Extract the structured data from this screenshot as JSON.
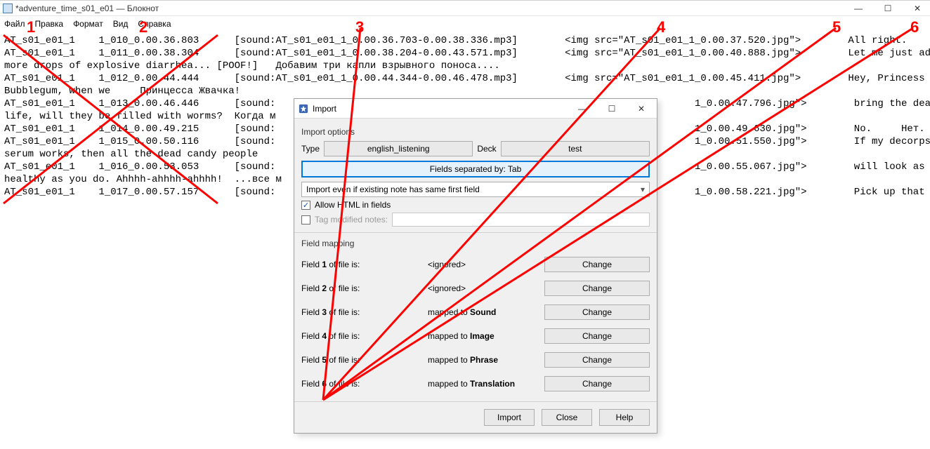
{
  "notepad": {
    "title": "*adventure_time_s01_e01 — Блокнот",
    "menu": [
      "Файл",
      "Правка",
      "Формат",
      "Вид",
      "Справка"
    ],
    "content": "AT_s01_e01_1    1_010_0.00.36.803      [sound:AT_s01_e01_1_0.00.36.703-0.00.38.336.mp3]        <img src=\"AT_s01_e01_1_0.00.37.520.jpg\">        All right.      Итак!\nAT_s01_e01_1    1_011_0.00.38.304      [sound:AT_s01_e01_1_0.00.38.204-0.00.43.571.mp3]        <img src=\"AT_s01_e01_1_0.00.40.888.jpg\">        Let me just add three\nmore drops of explosive diarrhea... [POOF!]   Добавим три капли взрывного поноса....\nAT_s01_e01_1    1_012_0.00.44.444      [sound:AT_s01_e01_1_0.00.44.344-0.00.46.478.mp3]        <img src=\"AT_s01_e01_1_0.00.45.411.jpg\">        Hey, Princess\nBubblegum, when we     Принцесса Жвачка!\nAT_s01_e01_1    1_013_0.00.46.446      [sound:                                                                       1_0.00.47.796.jpg\">        bring the dead back t\nlife, will they be filled with worms?  Когда м\nAT_s01_e01_1    1_014_0.00.49.215      [sound:                                                                       1_0.00.49.630.jpg\">        No.     Нет.\nAT_s01_e01_1    1_015_0.00.50.116      [sound:                                                                       1_0.00.51.550.jpg\">        If my decorpsinator\nserum works, then all the dead candy people\nAT_s01_e01_1    1_016_0.00.53.053      [sound:                                                                       1_0.00.55.067.jpg\">        will look as young an\nhealthy as you do. Ahhhh-ahhhh-ahhhh!  ...все м\nAT_s01_e01_1    1_017_0.00.57.157      [sound:                                                                       1_0.00.58.221.jpg\">        Pick up that platter."
  },
  "dialog": {
    "title": "Import",
    "section_options": "Import options",
    "type_label": "Type",
    "type_value": "english_listening",
    "deck_label": "Deck",
    "deck_value": "test",
    "fields_sep_btn": "Fields separated by: Tab",
    "import_mode": "Import even if existing note has same first field",
    "allow_html": "Allow HTML in fields",
    "tag_modified": "Tag modified notes:",
    "section_fieldmap": "Field mapping",
    "fields": [
      {
        "idx": "1",
        "label_pre": "Field ",
        "label_post": " of file is:",
        "value": "<ignored>",
        "value_b": "",
        "btn": "Change"
      },
      {
        "idx": "2",
        "label_pre": "Field ",
        "label_post": " of file is:",
        "value": "<ignored>",
        "value_b": "",
        "btn": "Change"
      },
      {
        "idx": "3",
        "label_pre": "Field ",
        "label_post": " of file is:",
        "value": "mapped to ",
        "value_b": "Sound",
        "btn": "Change"
      },
      {
        "idx": "4",
        "label_pre": "Field ",
        "label_post": " of file is:",
        "value": "mapped to ",
        "value_b": "Image",
        "btn": "Change"
      },
      {
        "idx": "5",
        "label_pre": "Field ",
        "label_post": " of file is:",
        "value": "mapped to ",
        "value_b": "Phrase",
        "btn": "Change"
      },
      {
        "idx": "6",
        "label_pre": "Field ",
        "label_post": " of file is:",
        "value": "mapped to ",
        "value_b": "Translation",
        "btn": "Change"
      }
    ],
    "footer": {
      "import": "Import",
      "close": "Close",
      "help": "Help"
    }
  },
  "annotations": {
    "n1": "1",
    "n2": "2",
    "n3": "3",
    "n4": "4",
    "n5": "5",
    "n6": "6"
  }
}
